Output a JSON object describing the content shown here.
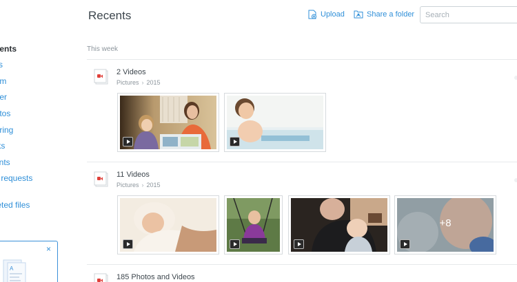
{
  "header": {
    "title": "Recents",
    "upload_label": "Upload",
    "share_folder_label": "Share a folder",
    "search_placeholder": "Search"
  },
  "sidebar": {
    "items": [
      {
        "label": "ecents",
        "active": true
      },
      {
        "label": "iles"
      },
      {
        "label": "eam"
      },
      {
        "label": "aper"
      },
      {
        "label": "hotos"
      },
      {
        "label": "haring"
      },
      {
        "label": "inks"
      },
      {
        "label": "vents"
      },
      {
        "label": "ile requests"
      },
      {
        "label": "eleted files"
      }
    ],
    "upsell_close": "×"
  },
  "main": {
    "section_label": "This week",
    "groups": [
      {
        "title": "2 Videos",
        "path": [
          "Pictures",
          "2015"
        ],
        "thumbs": [
          {
            "type": "video"
          },
          {
            "type": "video"
          }
        ]
      },
      {
        "title": "11 Videos",
        "path": [
          "Pictures",
          "2015"
        ],
        "thumbs": [
          {
            "type": "video"
          },
          {
            "type": "video"
          },
          {
            "type": "video"
          },
          {
            "type": "video",
            "more": "+8"
          }
        ]
      },
      {
        "title": "185 Photos and Videos"
      }
    ]
  },
  "colors": {
    "accent": "#2f8fd8",
    "video_icon": "#e0403a"
  },
  "icons": {
    "upload": "file-upload-icon",
    "share_folder": "shared-folder-icon",
    "group": "video-file-icon",
    "play": "play-icon",
    "close": "close-icon"
  }
}
